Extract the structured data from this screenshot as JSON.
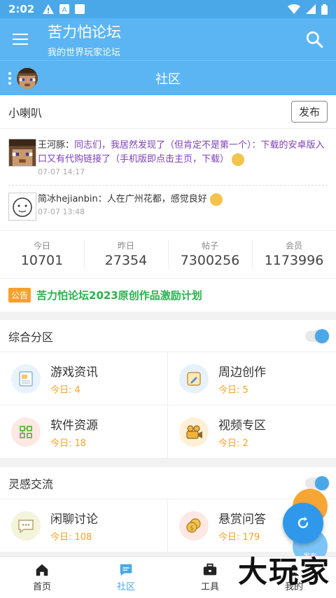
{
  "status": {
    "time": "2:02"
  },
  "app": {
    "title": "苦力怕论坛",
    "subtitle": "我的世界玩家论坛"
  },
  "section": {
    "title": "社区"
  },
  "speaker": {
    "label": "小喇叭",
    "publish_label": "发布",
    "posts": [
      {
        "user": "王河豚：",
        "text": "同志们，我居然发现了（但肯定不是第一个）：下载的安卓版入口又有代购链接了（手机版即点击主页，下载）",
        "date": "07-07 14:17"
      },
      {
        "user": "简冰hejianbin：",
        "text": "人在广州花都，感觉良好",
        "date": "07-07 13:48"
      }
    ]
  },
  "stats": [
    {
      "label": "今日",
      "value": "10701"
    },
    {
      "label": "昨日",
      "value": "27354"
    },
    {
      "label": "帖子",
      "value": "7300256"
    },
    {
      "label": "会员",
      "value": "1173996"
    }
  ],
  "notice": {
    "tag": "公告",
    "text": "苦力怕论坛2023原创作品激励计划"
  },
  "groups": [
    {
      "title": "综合分区",
      "toggle_on": true,
      "items": [
        {
          "name": "游戏资讯",
          "today": "今日: 4",
          "icon": "news-icon"
        },
        {
          "name": "周边创作",
          "today": "今日: 5",
          "icon": "edit-icon"
        },
        {
          "name": "软件资源",
          "today": "今日: 18",
          "icon": "nodes-icon"
        },
        {
          "name": "视频专区",
          "today": "今日: 2",
          "icon": "camera-icon"
        }
      ]
    },
    {
      "title": "灵感交流",
      "toggle_on": true,
      "items": [
        {
          "name": "闲聊讨论",
          "today": "今日: 108",
          "icon": "chat-icon"
        },
        {
          "name": "悬赏问答",
          "today": "今日: 179",
          "icon": "coins-icon"
        }
      ]
    }
  ],
  "fab": {
    "secondary_label": "发布"
  },
  "nav": [
    {
      "label": "首页",
      "icon": "home-icon"
    },
    {
      "label": "社区",
      "icon": "community-icon",
      "active": true
    },
    {
      "label": "工具",
      "icon": "toolbox-icon"
    },
    {
      "label": "我的",
      "icon": "profile-icon"
    }
  ],
  "watermark": "大玩家",
  "colors": {
    "primary": "#5bb5f3",
    "accent_orange": "#f7a12b",
    "notice_green": "#2bb24c",
    "post_purple": "#7b3fb8"
  }
}
